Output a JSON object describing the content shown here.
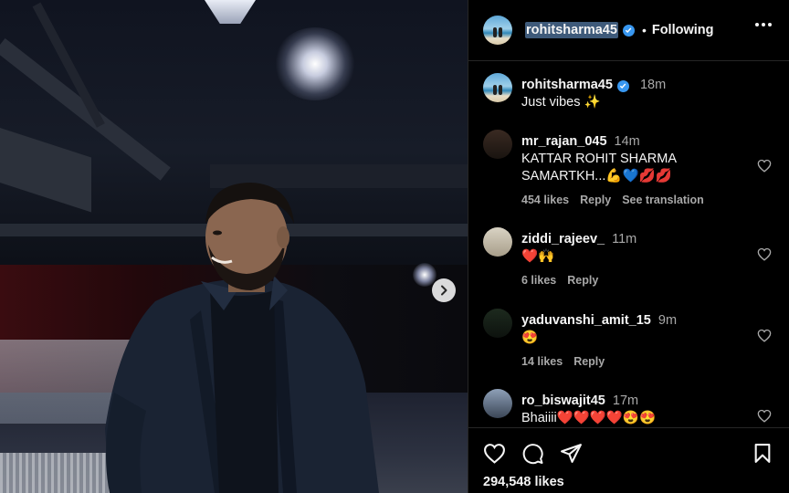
{
  "post": {
    "author": "rohitsharma45",
    "follow_dot": "•",
    "follow_status": "Following",
    "likes": "294,548 likes"
  },
  "caption": {
    "username": "rohitsharma45",
    "time": "18m",
    "text": "Just vibes ✨"
  },
  "comments": [
    {
      "username": "mr_rajan_045",
      "time": "14m",
      "text": "KATTAR ROHIT SHARMA SAMARTKH...💪💙💋💋",
      "likes": "454 likes",
      "reply": "Reply",
      "translate": "See translation"
    },
    {
      "username": "ziddi_rajeev_",
      "time": "11m",
      "text": "❤️🙌",
      "likes": "6 likes",
      "reply": "Reply"
    },
    {
      "username": "yaduvanshi_amit_15",
      "time": "9m",
      "text": "😍",
      "likes": "14 likes",
      "reply": "Reply"
    },
    {
      "username": "ro_biswajit45",
      "time": "17m",
      "text": "Bhaiiii❤️❤️❤️❤️😍😍"
    }
  ],
  "icons": {
    "verified": "verified-badge-icon",
    "more": "more-options-icon",
    "next": "chevron-right-icon",
    "like": "heart-icon",
    "comment": "comment-bubble-icon",
    "share": "paper-plane-icon",
    "save": "bookmark-icon"
  },
  "colors": {
    "background": "#000000",
    "verified": "#3897f0",
    "muted": "#a8a8a8"
  }
}
